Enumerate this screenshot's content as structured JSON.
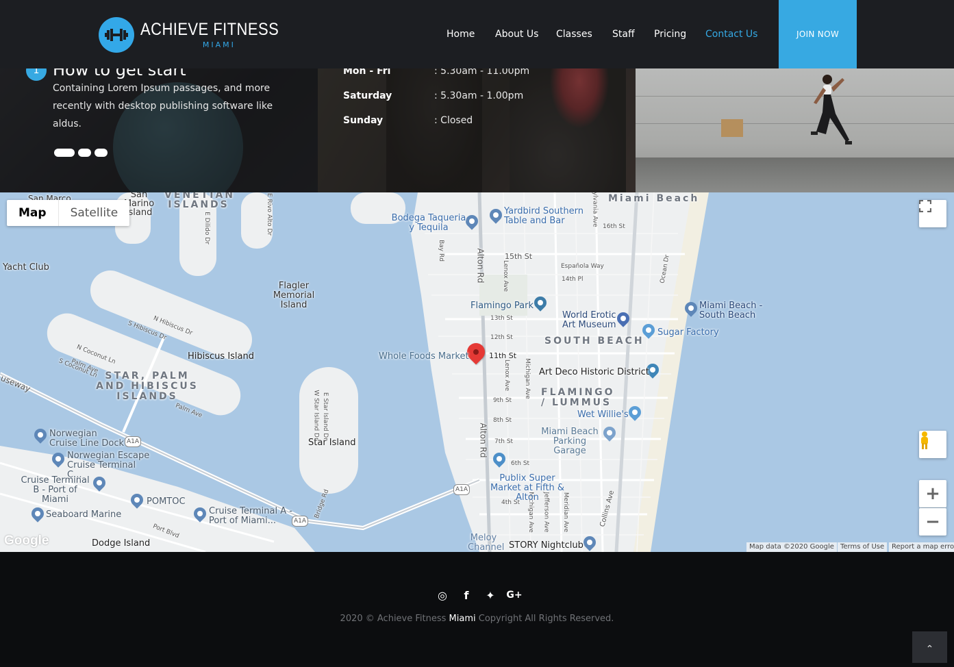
{
  "brand": {
    "name": "ACHIEVE FITNESS",
    "city": "MIAMI"
  },
  "nav": {
    "items": [
      {
        "label": "Home"
      },
      {
        "label": "About Us"
      },
      {
        "label": "Classes"
      },
      {
        "label": "Staff"
      },
      {
        "label": "Pricing"
      },
      {
        "label": "Contact Us",
        "active": true
      }
    ],
    "join_label": "JOIN NOW",
    "accent_color": "#37a9e2"
  },
  "promo": {
    "step_number": "1",
    "step_title": "How to get start",
    "step_text": "Containing Lorem Ipsum passages, and more recently with desktop publishing software like aldus.",
    "slider_dots": 3
  },
  "hours": [
    {
      "day": "Mon - Fri",
      "time": ": 5.30am - 11.00pm"
    },
    {
      "day": "Saturday",
      "time": ": 5.30am - 1.00pm"
    },
    {
      "day": "Sunday",
      "time": ": Closed"
    }
  ],
  "map": {
    "type_options": [
      "Map",
      "Satellite"
    ],
    "selected_type": "Map",
    "google_logo": "Google",
    "attribution": {
      "data": "Map data ©2020 Google",
      "terms": "Terms of Use",
      "report": "Report a map error"
    },
    "labels": {
      "miami_beach": "Miami Beach",
      "san_marino_island": "San Marino Island",
      "san_marco": "San Marco",
      "venetian_islands": "VENETIAN ISLANDS",
      "yacht_club": "Yacht Club",
      "flagler_memorial": "Flagler Memorial Island",
      "hibiscus_island": "Hibiscus Island",
      "star_palm_hibiscus": "STAR, PALM AND HIBISCUS ISLANDS",
      "star_island": "Star Island",
      "dodge_island": "Dodge Island",
      "south_beach": "SOUTH BEACH",
      "flamingo_lummus": "FLAMINGO / LUMMUS",
      "causeway": "useway",
      "melloy_channel": "Meloy Channel"
    },
    "pois": {
      "yardbird": "Yardbird Southern Table and Bar",
      "bodega": "Bodega Taqueria y Tequila",
      "flamingo_park": "Flamingo Park",
      "world_erotic": "World Erotic Art Museum",
      "miami_beach_south": "Miami Beach - South Beach",
      "sugar_factory": "Sugar Factory",
      "whole_foods": "Whole Foods Market",
      "art_deco": "Art Deco Historic District",
      "wet_willies": "Wet Willie's",
      "parking_garage": "Miami Beach Parking Garage",
      "publix": "Publix Super Market at Fifth & Alton",
      "story_nightclub": "STORY Nightclub",
      "norwegian_dock": "Norwegian Cruise Line Dock",
      "norwegian_terminal": "Norwegian Escape Cruise Terminal C...",
      "cruise_terminal_b": "Cruise Terminal B - Port of Miami",
      "pomtoc": "POMTOC",
      "seaboard": "Seaboard Marine",
      "cruise_terminal_a": "Cruise Terminal A - Port of Miami..."
    },
    "streets": {
      "alton_rd": "Alton Rd",
      "st_15": "15th St",
      "st_16": "16th St",
      "st_14": "14th Pl",
      "espanola": "Española Way",
      "st_13": "13th St",
      "st_12": "12th St",
      "st_11": "11th St",
      "st_9": "9th St",
      "st_8": "8th St",
      "st_7": "7th St",
      "st_6": "6th St",
      "st_4": "4th St",
      "collins": "Collins Ave",
      "ocean_dr": "Ocean Dr",
      "lenox": "Lenox Ave",
      "michigan": "Michigan Ave",
      "jefferson": "Jefferson Ave",
      "meridian": "Meridian Ave",
      "bay_rd": "Bay Rd",
      "a1a": "A1A",
      "port_blvd": "Port Blvd",
      "bridge_rd": "Bridge Rd",
      "n_hibiscus": "N Hibiscus Dr",
      "s_hibiscus": "S Hibiscus Dr",
      "palm_ave": "Palm Ave",
      "n_coconut": "N Coconut Ln",
      "s_coconut": "S Coconut Ln",
      "e_star": "E Star Island Dr",
      "w_star": "W Star Island Dr",
      "e_dilido": "E Dilido Dr",
      "e_rivo": "E Rivo Alto Dr",
      "sylvania": "Sylvania Ave"
    }
  },
  "footer": {
    "social": [
      "instagram",
      "facebook",
      "twitter",
      "google-plus"
    ],
    "social_glyphs": {
      "instagram": "◎",
      "facebook": "f",
      "twitter": "✦",
      "google-plus": "G+"
    },
    "copyright_pre": "2020 © Achieve Fitness",
    "copyright_brand": "Miami",
    "copyright_post": "Copyright All Rights Reserved.",
    "to_top": "⌃"
  }
}
